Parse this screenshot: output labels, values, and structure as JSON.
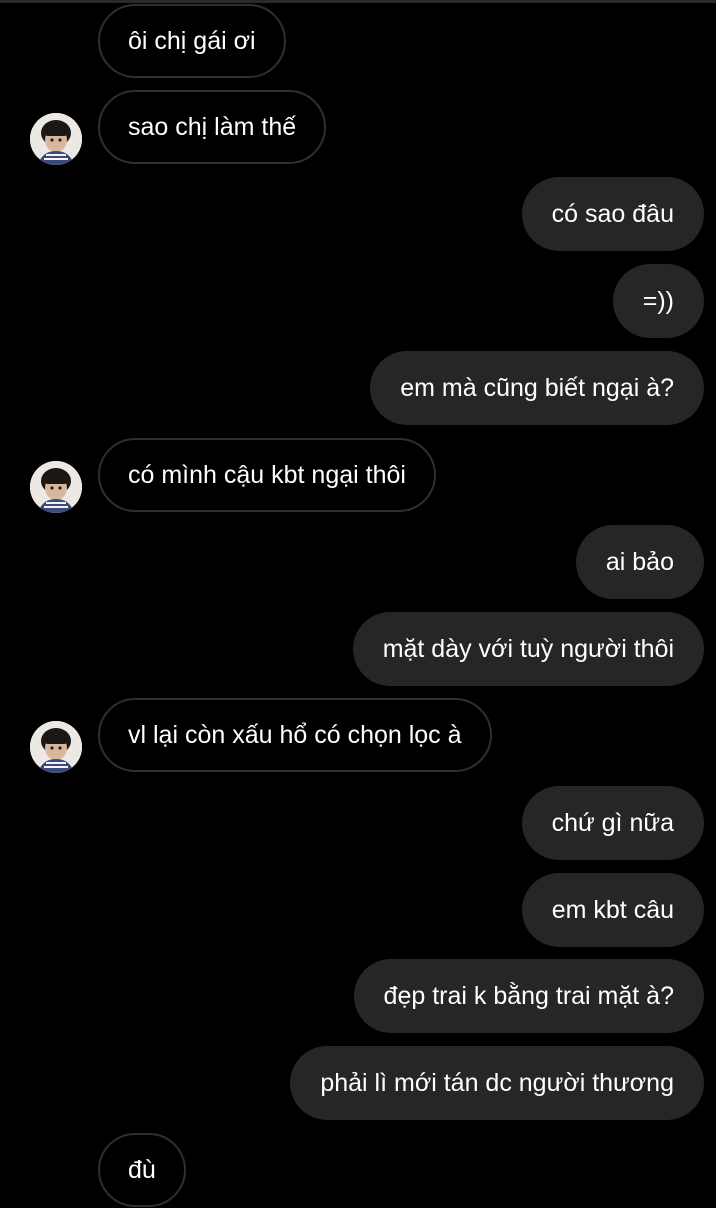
{
  "conversation": {
    "messages": [
      {
        "side": "in",
        "text": "ôi chị gái ơi",
        "avatar": false
      },
      {
        "side": "in",
        "text": "sao chị làm thế",
        "avatar": true
      },
      {
        "side": "out",
        "text": "có sao đâu"
      },
      {
        "side": "out",
        "text": "=))"
      },
      {
        "side": "out",
        "text": "em mà cũng biết ngại à?"
      },
      {
        "side": "in",
        "text": "có mình cậu kbt ngại thôi",
        "avatar": true
      },
      {
        "side": "out",
        "text": "ai bảo"
      },
      {
        "side": "out",
        "text": "mặt dày với tuỳ người thôi"
      },
      {
        "side": "in",
        "text": "vl lại còn xấu hổ có chọn lọc à",
        "avatar": true
      },
      {
        "side": "out",
        "text": "chứ gì nữa"
      },
      {
        "side": "out",
        "text": "em kbt câu"
      },
      {
        "side": "out",
        "text": "đẹp trai k bằng trai mặt à?"
      },
      {
        "side": "out",
        "text": "phải lì mới tán dc người thương"
      },
      {
        "side": "in",
        "text": "đù",
        "avatar": false
      }
    ]
  },
  "colors": {
    "background": "#000000",
    "outgoing_bubble": "#262626",
    "incoming_border": "#2f2f2f",
    "text": "#ffffff"
  }
}
